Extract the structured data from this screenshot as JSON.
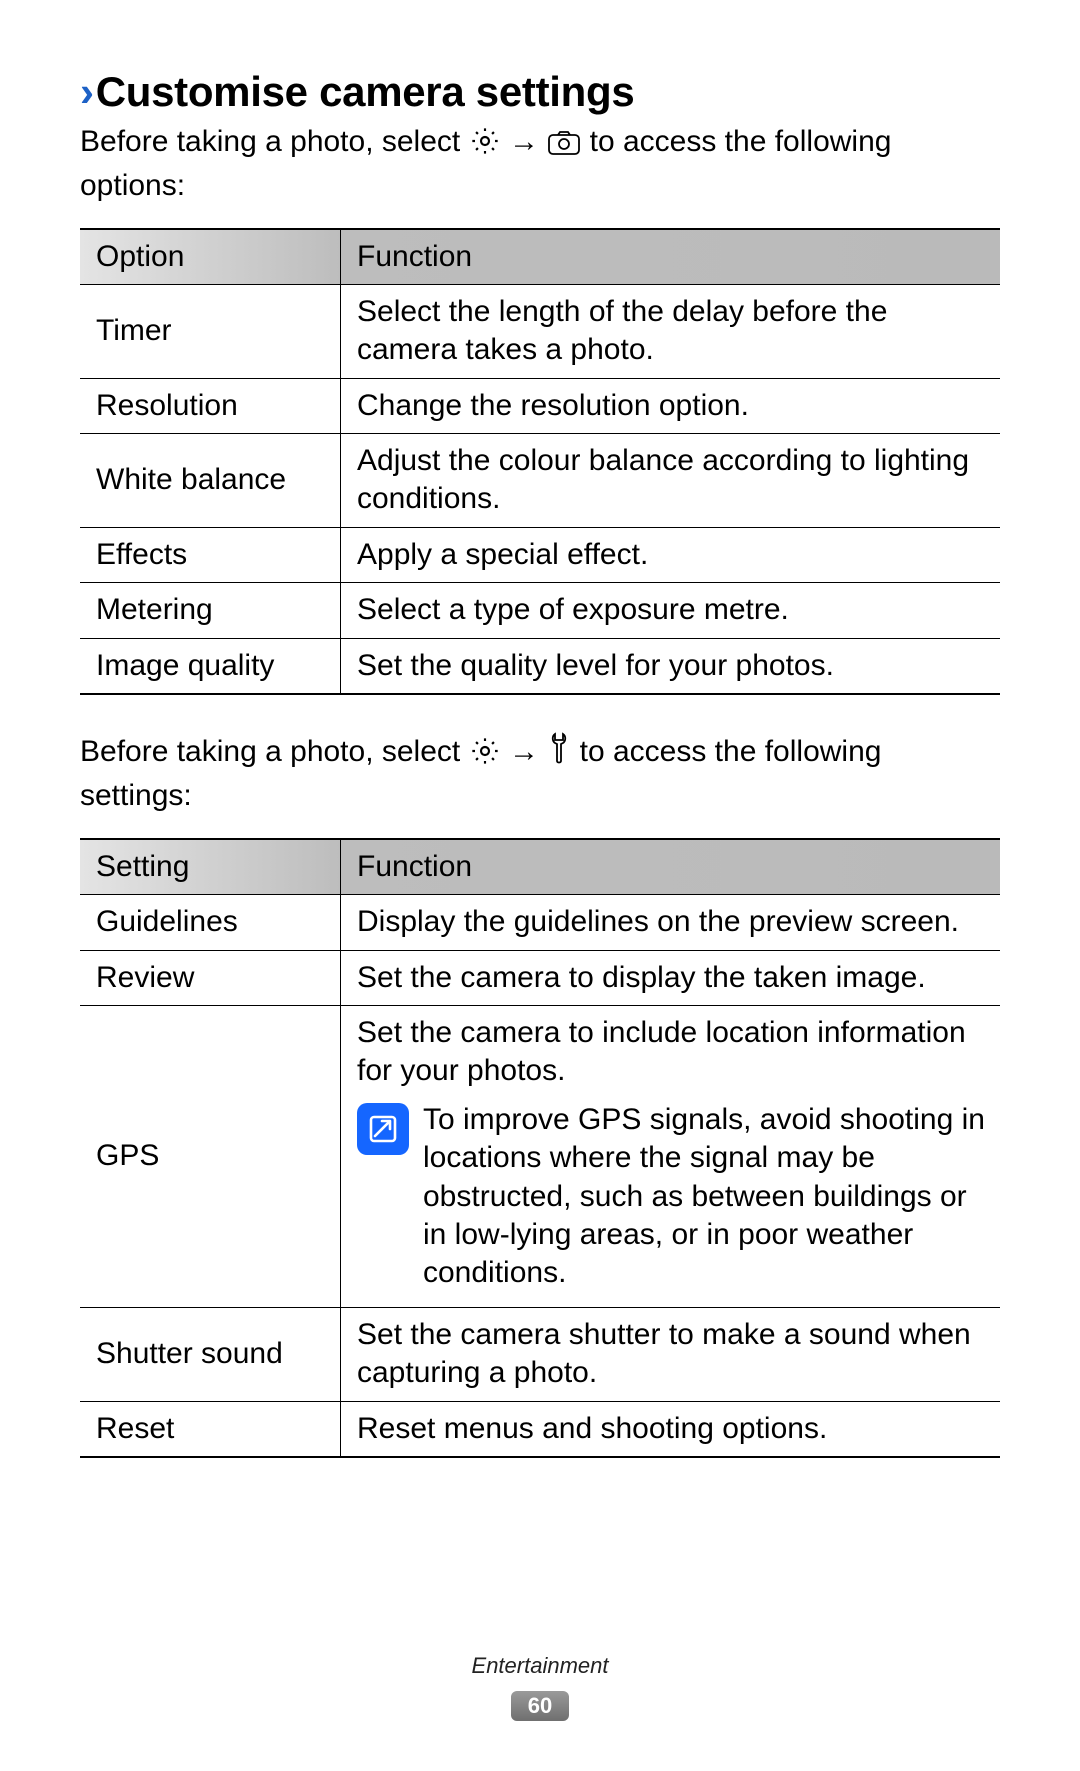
{
  "heading": "Customise camera settings",
  "intro1_a": "Before taking a photo, select ",
  "intro1_b": " → ",
  "intro1_c": " to access the following options:",
  "intro2_a": "Before taking a photo, select ",
  "intro2_b": " → ",
  "intro2_c": " to access the following settings:",
  "table1": {
    "head1": "Option",
    "head2": "Function",
    "rows": [
      {
        "opt": "Timer",
        "fn": "Select the length of the delay before the camera takes a photo."
      },
      {
        "opt": "Resolution",
        "fn": "Change the resolution option."
      },
      {
        "opt": "White balance",
        "fn": "Adjust the colour balance according to lighting conditions."
      },
      {
        "opt": "Effects",
        "fn": "Apply a special effect."
      },
      {
        "opt": "Metering",
        "fn": "Select a type of exposure metre."
      },
      {
        "opt": "Image quality",
        "fn": "Set the quality level for your photos."
      }
    ]
  },
  "table2": {
    "head1": "Setting",
    "head2": "Function",
    "rows": [
      {
        "opt": "Guidelines",
        "fn": "Display the guidelines on the preview screen."
      },
      {
        "opt": "Review",
        "fn": "Set the camera to display the taken image."
      },
      {
        "opt": "GPS",
        "fn": "Set the camera to include location information for your photos.",
        "note": "To improve GPS signals, avoid shooting in locations where the signal may be obstructed, such as between buildings or in low-lying areas, or in poor weather conditions."
      },
      {
        "opt": "Shutter sound",
        "fn": "Set the camera shutter to make a sound when capturing a photo."
      },
      {
        "opt": "Reset",
        "fn": "Reset menus and shooting options."
      }
    ]
  },
  "footer": {
    "section": "Entertainment",
    "page": "60"
  }
}
